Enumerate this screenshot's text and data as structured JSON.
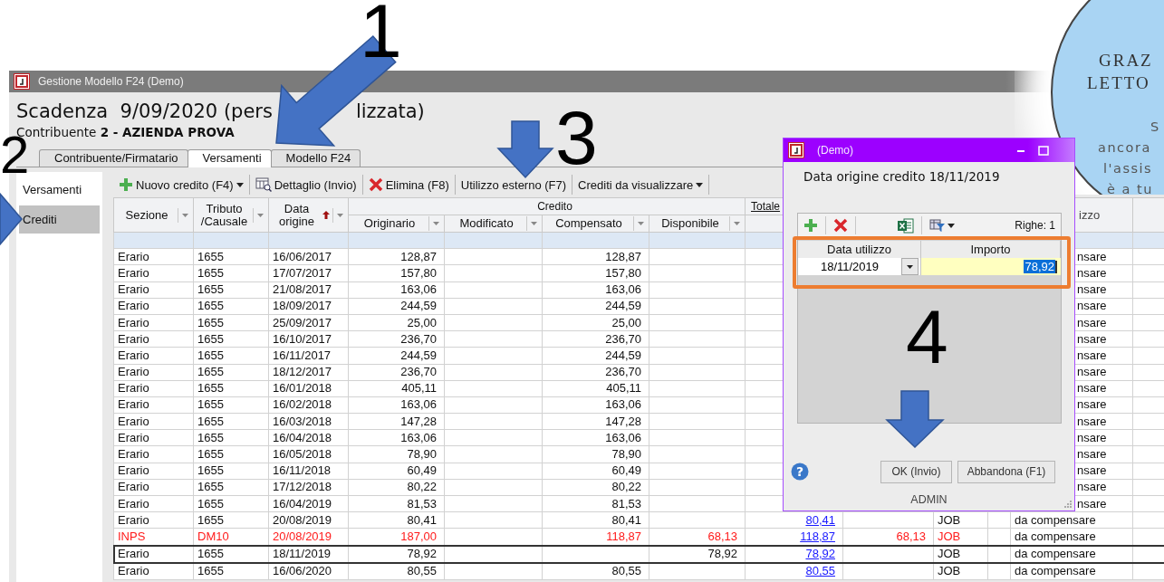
{
  "window": {
    "title": "Gestione Modello F24  (Demo)"
  },
  "header": {
    "title_start": "Scadenza  9/09/2020 (pers",
    "title_end": "lizzata)",
    "taxpayer": "Contribuente **2 - AZIENDA PROVA**"
  },
  "tabs": [
    {
      "label": "Contribuente/Firmatario",
      "selected": false
    },
    {
      "label": "Versamenti",
      "selected": true
    },
    {
      "label": "Modello F24",
      "selected": false
    }
  ],
  "sidebar": {
    "items": [
      {
        "label": "Versamenti",
        "selected": false
      },
      {
        "label": "Crediti",
        "selected": true
      }
    ]
  },
  "toolbar": [
    {
      "label": "Nuovo credito (F4)",
      "kind": "add",
      "menu": true
    },
    {
      "label": "Dettaglio (Invio)",
      "kind": "details",
      "menu": false
    },
    {
      "label": "Elimina (F8)",
      "kind": "remove",
      "menu": false
    },
    {
      "label": "Utilizzo esterno (F7)",
      "kind": "text",
      "menu": false
    },
    {
      "label": "Crediti da visualizzare",
      "kind": "text",
      "menu": true
    }
  ],
  "table": {
    "header": [
      {
        "lines": [
          "Sezione"
        ],
        "filter": true
      },
      {
        "lines": [
          "Tributo",
          "/Causale"
        ],
        "filter": true
      },
      {
        "lines": [
          "Data",
          "origine"
        ],
        "filter": true,
        "sorted": true
      },
      {
        "group": "Credito",
        "columns": [
          {
            "lines": [
              "Originario"
            ],
            "filter": true
          },
          {
            "lines": [
              "Modificato"
            ],
            "filter": true
          },
          {
            "lines": [
              "Compensato"
            ],
            "filter": true
          },
          {
            "lines": [
              "Disponibile"
            ],
            "filter": true
          }
        ]
      },
      {
        "group": "Totale"
      },
      {
        "lines": [
          "izzo"
        ],
        "filter": false,
        "covered": true
      },
      {
        "filter": false
      }
    ],
    "rows": [
      {
        "sezione": "Erario",
        "tributo": "1655",
        "data_origine": "16/06/2017",
        "originario": "128,87",
        "compensato": "128,87",
        "column_12": "nsare",
        "covered": true,
        "alert": false,
        "current": false
      },
      {
        "sezione": "Erario",
        "tributo": "1655",
        "data_origine": "17/07/2017",
        "originario": "157,80",
        "compensato": "157,80",
        "column_12": "nsare",
        "covered": true,
        "alert": false,
        "current": false
      },
      {
        "sezione": "Erario",
        "tributo": "1655",
        "data_origine": "21/08/2017",
        "originario": "163,06",
        "compensato": "163,06",
        "column_12": "nsare",
        "covered": true,
        "alert": false,
        "current": false
      },
      {
        "sezione": "Erario",
        "tributo": "1655",
        "data_origine": "18/09/2017",
        "originario": "244,59",
        "compensato": "244,59",
        "column_12": "nsare",
        "covered": true,
        "alert": false,
        "current": false
      },
      {
        "sezione": "Erario",
        "tributo": "1655",
        "data_origine": "25/09/2017",
        "originario": "25,00",
        "compensato": "25,00",
        "column_12": "nsare",
        "covered": true,
        "alert": false,
        "current": false
      },
      {
        "sezione": "Erario",
        "tributo": "1655",
        "data_origine": "16/10/2017",
        "originario": "236,70",
        "compensato": "236,70",
        "column_12": "nsare",
        "covered": true,
        "alert": false,
        "current": false
      },
      {
        "sezione": "Erario",
        "tributo": "1655",
        "data_origine": "16/11/2017",
        "originario": "244,59",
        "compensato": "244,59",
        "column_12": "nsare",
        "covered": true,
        "alert": false,
        "current": false
      },
      {
        "sezione": "Erario",
        "tributo": "1655",
        "data_origine": "18/12/2017",
        "originario": "236,70",
        "compensato": "236,70",
        "column_12": "nsare",
        "covered": true,
        "alert": false,
        "current": false
      },
      {
        "sezione": "Erario",
        "tributo": "1655",
        "data_origine": "16/01/2018",
        "originario": "405,11",
        "compensato": "405,11",
        "column_12": "nsare",
        "covered": true,
        "alert": false,
        "current": false
      },
      {
        "sezione": "Erario",
        "tributo": "1655",
        "data_origine": "16/02/2018",
        "originario": "163,06",
        "compensato": "163,06",
        "column_12": "nsare",
        "covered": true,
        "alert": false,
        "current": false
      },
      {
        "sezione": "Erario",
        "tributo": "1655",
        "data_origine": "16/03/2018",
        "originario": "147,28",
        "compensato": "147,28",
        "column_12": "nsare",
        "covered": true,
        "alert": false,
        "current": false
      },
      {
        "sezione": "Erario",
        "tributo": "1655",
        "data_origine": "16/04/2018",
        "originario": "163,06",
        "compensato": "163,06",
        "column_12": "nsare",
        "covered": true,
        "alert": false,
        "current": false
      },
      {
        "sezione": "Erario",
        "tributo": "1655",
        "data_origine": "16/05/2018",
        "originario": "78,90",
        "compensato": "78,90",
        "column_12": "nsare",
        "covered": true,
        "alert": false,
        "current": false
      },
      {
        "sezione": "Erario",
        "tributo": "1655",
        "data_origine": "16/11/2018",
        "originario": "60,49",
        "compensato": "60,49",
        "column_12": "nsare",
        "covered": true,
        "alert": false,
        "current": false
      },
      {
        "sezione": "Erario",
        "tributo": "1655",
        "data_origine": "17/12/2018",
        "originario": "80,22",
        "compensato": "80,22",
        "column_12": "nsare",
        "covered": true,
        "alert": false,
        "current": false
      },
      {
        "sezione": "Erario",
        "tributo": "1655",
        "data_origine": "16/04/2019",
        "originario": "81,53",
        "compensato": "81,53",
        "column_12": "nsare",
        "covered": true,
        "alert": false,
        "current": false
      },
      {
        "sezione": "Erario",
        "tributo": "1655",
        "data_origine": "20/08/2019",
        "originario": "80,41",
        "compensato": "80,41",
        "totale": "80,41",
        "column_10": "JOB",
        "column_12": "da compensare",
        "covered": false,
        "alert": false,
        "current": false
      },
      {
        "sezione": "INPS",
        "tributo": "DM10",
        "data_origine": "20/08/2019",
        "originario": "187,00",
        "compensato": "118,87",
        "disponibile": "68,13",
        "totale": "118,87",
        "column_9": "68,13",
        "column_10": "JOB",
        "column_12": "da compensare",
        "covered": false,
        "alert": true,
        "current": false
      },
      {
        "sezione": "Erario",
        "tributo": "1655",
        "data_origine": "18/11/2019",
        "originario": "78,92",
        "disponibile": "78,92",
        "totale": "78,92",
        "column_10": "JOB",
        "column_12": "da compensare",
        "covered": false,
        "alert": false,
        "current": true
      },
      {
        "sezione": "Erario",
        "tributo": "1655",
        "data_origine": "16/06/2020",
        "originario": "80,55",
        "compensato": "80,55",
        "totale": "80,55",
        "column_10": "JOB",
        "column_12": "da compensare",
        "covered": false,
        "alert": false,
        "current": false
      }
    ]
  },
  "dialog": {
    "title": "(Demo)",
    "heading": "Data origine credito 18/11/2019",
    "row_count": "Righe: 1",
    "columns": [
      "Data utilizzo",
      "Importo"
    ],
    "rows": [
      {
        "date": "18/11/2019",
        "amount": "78,92",
        "amount_selected": true
      }
    ],
    "help": "?",
    "buttons": [
      "OK (Invio)",
      "Abbandona (F1)"
    ],
    "user": "ADMIN"
  },
  "annotations": [
    "1",
    "2",
    "3",
    "4"
  ],
  "note_bubble": {
    "heading": [
      "GRAZ",
      "LETTO"
    ],
    "body": [
      "S",
      "ancora",
      "l'assis",
      "è a tu"
    ]
  }
}
